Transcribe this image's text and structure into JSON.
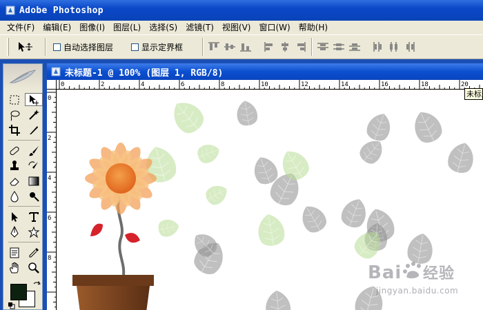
{
  "app": {
    "title": "Adobe Photoshop"
  },
  "menu": [
    "文件(F)",
    "编辑(E)",
    "图像(I)",
    "图层(L)",
    "选择(S)",
    "滤镜(T)",
    "视图(V)",
    "窗口(W)",
    "帮助(H)"
  ],
  "options": {
    "auto_select_label": "自动选择图层",
    "auto_select_checked": false,
    "show_bounds_label": "显示定界框",
    "show_bounds_checked": false
  },
  "document": {
    "title": "未标题-1 @ 100% (图层 1, RGB/8)"
  },
  "ruler": {
    "h_labels": [
      "0",
      "2",
      "4",
      "6",
      "8",
      "10",
      "12",
      "14",
      "16",
      "18",
      "20"
    ],
    "v_labels": [
      "0",
      "2",
      "4",
      "6",
      "8"
    ]
  },
  "tooltip": {
    "text": "未标题"
  },
  "colors": {
    "foreground": "#0d2110",
    "background": "#ffffff",
    "accent": "#0a48c8"
  },
  "icons": [
    "photoshop-app-icon",
    "move-icon",
    "marquee-icon",
    "lasso-icon",
    "magic-wand-icon",
    "crop-icon",
    "slice-icon",
    "healing-brush-icon",
    "brush-icon",
    "clone-stamp-icon",
    "history-brush-icon",
    "eraser-icon",
    "gradient-icon",
    "blur-icon",
    "dodge-icon",
    "path-selection-icon",
    "type-icon",
    "pen-icon",
    "shape-icon",
    "notes-icon",
    "eyedropper-icon",
    "hand-icon",
    "zoom-icon",
    "feather-icon",
    "swap-colors-icon",
    "default-colors-icon"
  ],
  "watermark": {
    "logo": "Bai经验",
    "url": "jingyan.baidu.com"
  }
}
